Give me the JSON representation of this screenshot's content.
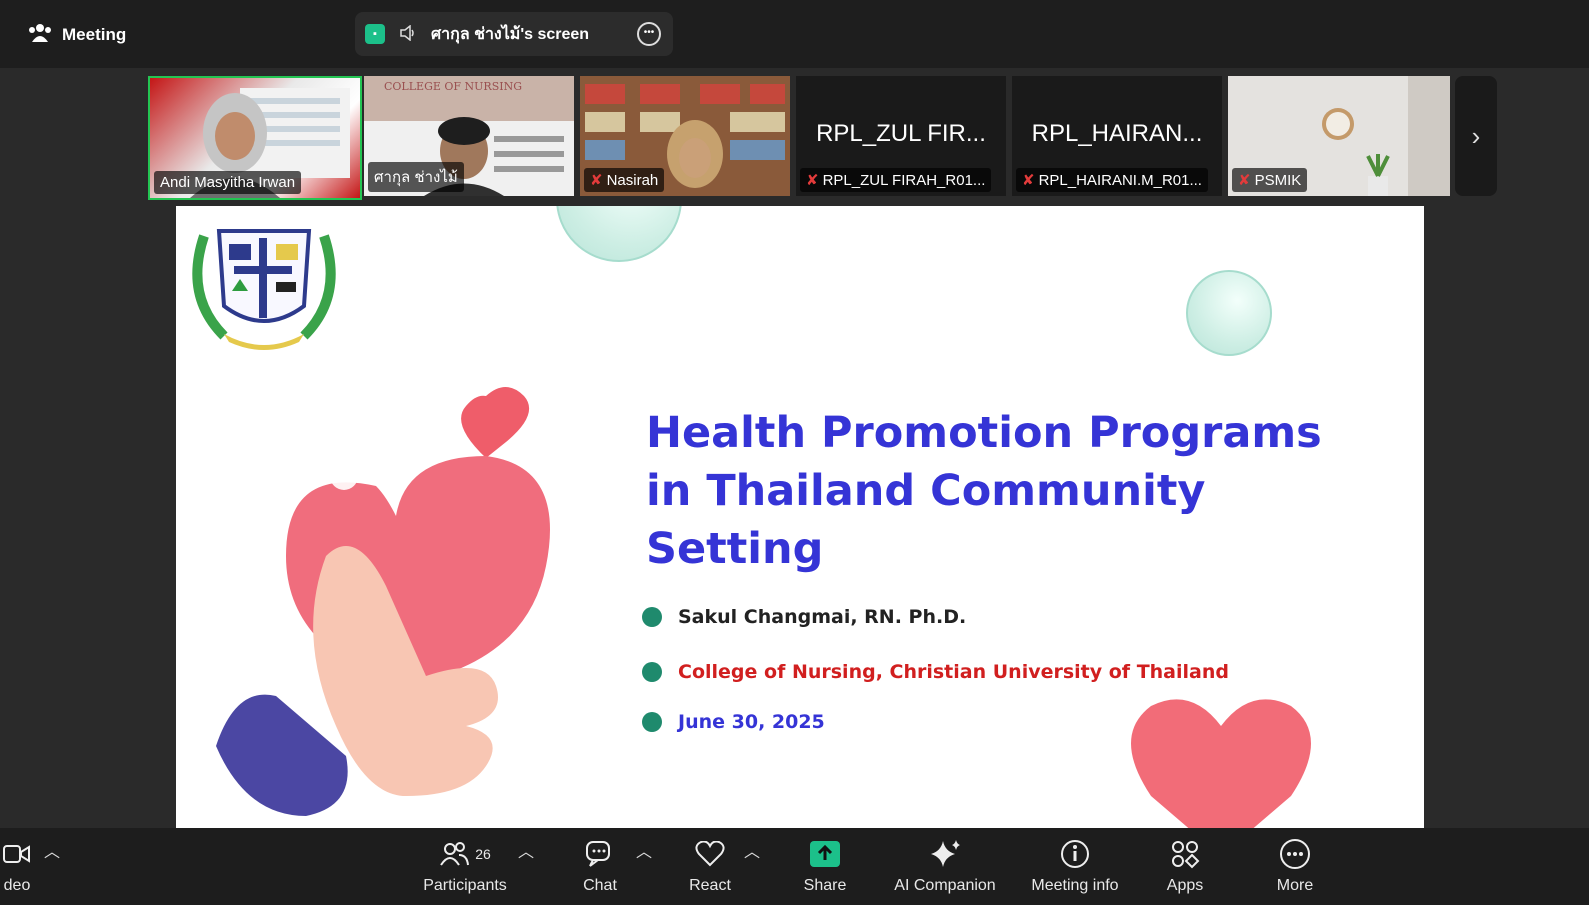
{
  "topbar": {
    "meeting_label": "Meeting",
    "share_label": "ศากุล ช่างไม้'s screen"
  },
  "participants": [
    {
      "name": "Andi Masyitha Irwan",
      "muted": false
    },
    {
      "name": "ศากุล ช่างไม้",
      "muted": false
    },
    {
      "name": "Nasirah",
      "muted": true
    },
    {
      "display": "RPL_ZUL FIR...",
      "name": "RPL_ZUL FIRAH_R01...",
      "muted": true
    },
    {
      "display": "RPL_HAIRAN...",
      "name": "RPL_HAIRANI.M_R01...",
      "muted": true
    },
    {
      "name": "PSMIK",
      "muted": true
    }
  ],
  "slide": {
    "title_line1": "Health Promotion Programs",
    "title_line2": "in Thailand Community",
    "title_line3": "Setting",
    "presenter": "Sakul Changmai, RN. Ph.D.",
    "institution": "College of Nursing, Christian University of Thailand",
    "date": "June 30, 2025",
    "colors": {
      "title": "#3534d6",
      "institution": "#d11f1f",
      "date": "#3534d6",
      "bullet": "#1f8a6d"
    }
  },
  "toolbar": {
    "video_label": "deo",
    "participants_label": "Participants",
    "participants_count": "26",
    "chat_label": "Chat",
    "react_label": "React",
    "share_label": "Share",
    "ai_label": "AI Companion",
    "info_label": "Meeting info",
    "apps_label": "Apps",
    "more_label": "More"
  }
}
